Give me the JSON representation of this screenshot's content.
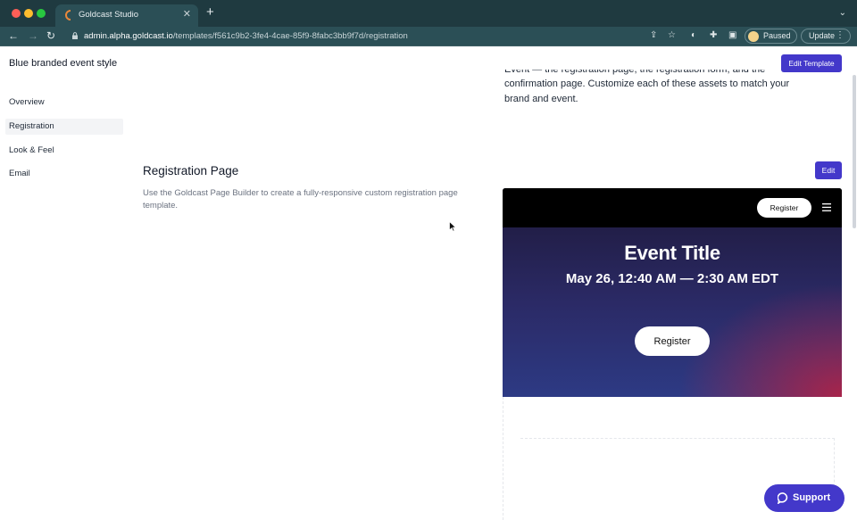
{
  "browser": {
    "tab_title": "Goldcast Studio",
    "tab_close": "✕",
    "new_tab": "+",
    "tab_menu": "⌄",
    "url_host": "admin.alpha.goldcast.io",
    "url_path": "/templates/f561c9b2-3fe4-4cae-85f9-8fabc3bb9f7d/registration",
    "profile_label": "Paused",
    "update_label": "Update"
  },
  "app": {
    "title": "Blue branded event style",
    "edit_template_label": "Edit Template"
  },
  "sidebar": {
    "items": [
      {
        "label": "Overview",
        "active": false
      },
      {
        "label": "Registration",
        "active": true
      },
      {
        "label": "Look & Feel",
        "active": false
      },
      {
        "label": "Email",
        "active": false
      }
    ]
  },
  "intro": {
    "line1": "Event — the registration page, the registration form, and the",
    "line2": "confirmation page. Customize each of these assets to match your",
    "line3": "brand and event."
  },
  "registration_page": {
    "title": "Registration Page",
    "description": "Use the Goldcast Page Builder to create a fully-responsive custom registration page template.",
    "edit_label": "Edit"
  },
  "preview": {
    "header_register_label": "Register",
    "event_title": "Event Title",
    "event_date": "May 26, 12:40 AM — 2:30 AM EDT",
    "register_label": "Register"
  },
  "support": {
    "label": "Support"
  },
  "colors": {
    "primary": "#4338ca",
    "chrome_bg": "#1f3a40"
  }
}
